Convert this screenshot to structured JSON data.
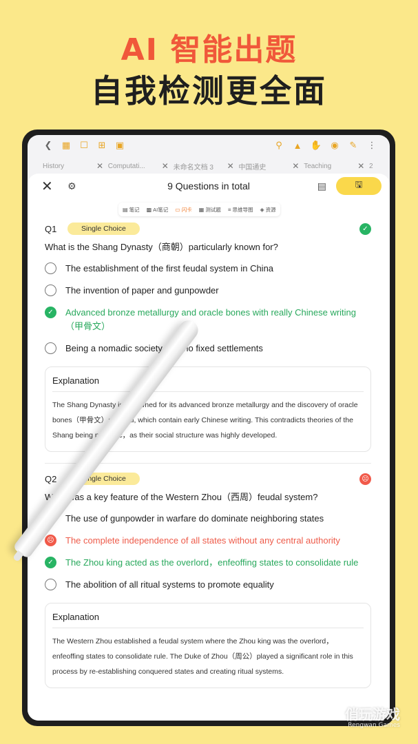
{
  "promo": {
    "headline_accent": "AI 智能出题",
    "headline_main": "自我检测更全面"
  },
  "toolbar": {
    "left_icons": [
      "back-icon",
      "grid-icon",
      "bookmark-icon",
      "add-icon",
      "crop-icon"
    ],
    "right_icons": [
      "search-icon",
      "shirt-icon",
      "hand-icon",
      "eye-icon",
      "pen-note-icon",
      "more-icon"
    ]
  },
  "tabs": [
    {
      "label": "History"
    },
    {
      "label": "Computati..."
    },
    {
      "label": "未命名文档 3"
    },
    {
      "label": "中国通史"
    },
    {
      "label": "Teaching"
    },
    {
      "label": "2"
    }
  ],
  "panel": {
    "title": "9 Questions in total",
    "save_label": "🖫"
  },
  "subtoolbar": [
    {
      "label": "笔记",
      "icon": "note-icon"
    },
    {
      "label": "AI笔记",
      "icon": "ai-note-icon"
    },
    {
      "label": "闪卡",
      "icon": "flashcard-icon",
      "active": true
    },
    {
      "label": "测试题",
      "icon": "quiz-icon"
    },
    {
      "label": "思维导图",
      "icon": "mindmap-icon"
    },
    {
      "label": "资源",
      "icon": "resource-icon"
    }
  ],
  "questions": [
    {
      "number": "Q1",
      "type": "Single Choice",
      "status": "correct",
      "text": "What is the Shang Dynasty（商朝）particularly known for?",
      "options": [
        {
          "text": "The establishment of the first feudal system in China",
          "state": "none"
        },
        {
          "text": "The invention of paper and gunpowder",
          "state": "none"
        },
        {
          "text": "Advanced bronze metallurgy and oracle bones with really Chinese writing（甲骨文）",
          "state": "correct"
        },
        {
          "text": "Being a nomadic society with no fixed settlements",
          "state": "none"
        }
      ],
      "explanation_title": "Explanation",
      "explanation": "The Shang Dynasty is renowned for its advanced bronze metallurgy and the discovery of oracle bones（甲骨文）at Yinxu, which contain early Chinese writing. This contradicts theories of the Shang being nomadic，as their social structure was highly developed."
    },
    {
      "number": "Q2",
      "type": "Single Choice",
      "status": "wrong",
      "text": "What was a key feature of the Western Zhou（西周）feudal system?",
      "options": [
        {
          "text": "The use of gunpowder in warfare do dominate neighboring states",
          "state": "none"
        },
        {
          "text": "The complete independence of all  states without any  central authority",
          "state": "wrong"
        },
        {
          "text": "The Zhou king acted as the overlord，enfeoffing states to consolidate rule",
          "state": "correct"
        },
        {
          "text": "The abolition of all ritual systems to promote equality",
          "state": "none"
        }
      ],
      "explanation_title": "Explanation",
      "explanation": "The Western Zhou established a feudal system where the Zhou king was the overlord，enfeoffing states to consolidate rule. The Duke of Zhou（周公）played a significant role in this process by re-establishing conquered states and creating ritual systems."
    }
  ],
  "watermark": {
    "main": "俏玩游戏",
    "sub": "Rengwan Games"
  },
  "colors": {
    "background": "#FBE88A",
    "accent": "#F0583A",
    "correct": "#28B464",
    "wrong": "#F15A4A",
    "save": "#FAD84B"
  }
}
